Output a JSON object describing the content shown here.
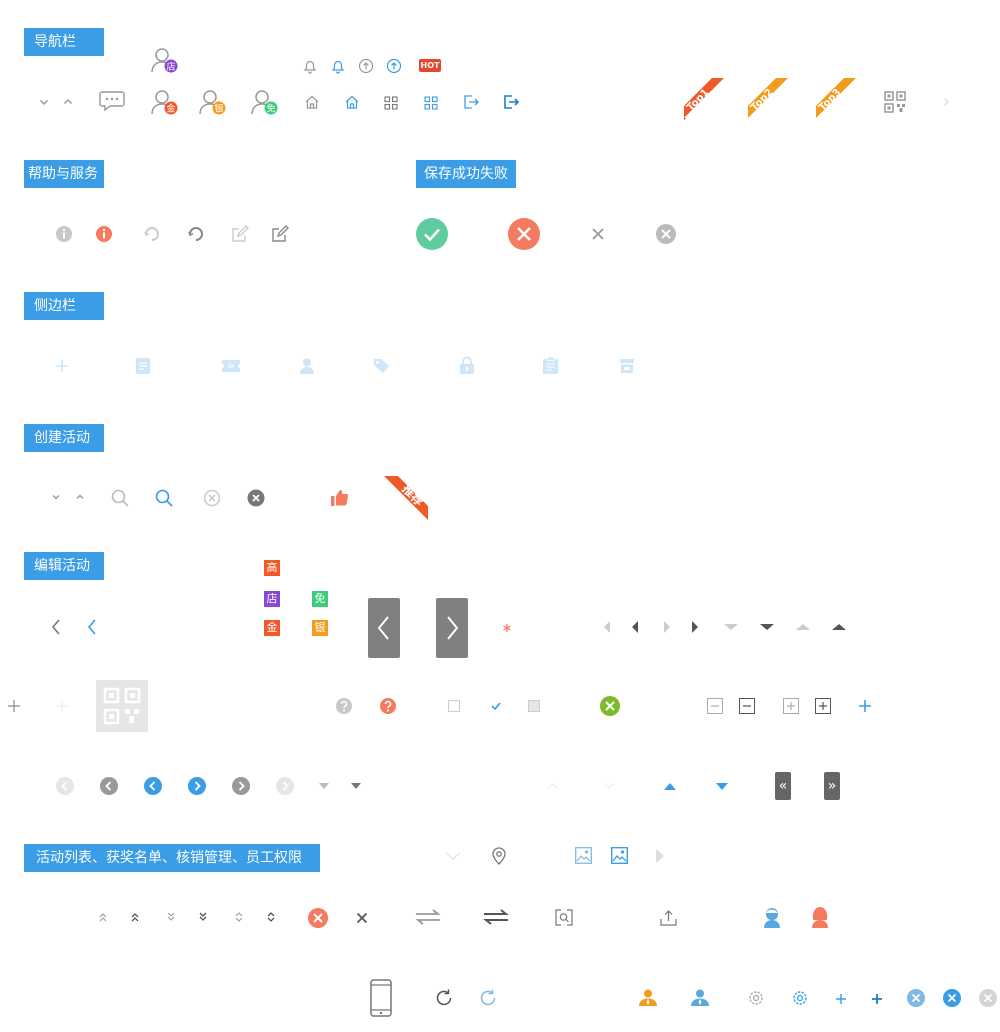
{
  "sections": {
    "nav": "导航栏",
    "help": "帮助与服务",
    "save": "保存成功失败",
    "sidebar": "侧边栏",
    "create": "创建活动",
    "edit": "编辑活动",
    "list": "活动列表、获奖名单、核销管理、员工权限"
  },
  "badges": {
    "shop": "店",
    "gold": "金",
    "silver": "银",
    "free": "免",
    "high": "高",
    "hot": "HOT",
    "top1": "Top1",
    "top2": "Top2",
    "top3": "Top3",
    "recommend": "推荐"
  },
  "colors": {
    "primary": "#3a9de5",
    "success": "#5ecc9e",
    "error": "#f47a60",
    "orange": "#f39b1e",
    "red": "#f05a28",
    "purple": "#8b47d6",
    "green": "#3dcc7a",
    "gray": "#999999",
    "light": "#cfe6f8"
  },
  "icons": [
    "chevron-down-icon",
    "chevron-up-icon",
    "message-icon",
    "user-shop-icon",
    "user-gold-icon",
    "user-silver-icon",
    "user-free-icon",
    "bell-icon",
    "arrow-up-circle-icon",
    "home-icon",
    "grid-icon",
    "logout-icon",
    "qr-code-icon",
    "info-icon",
    "refresh-icon",
    "edit-icon",
    "check-circle-icon",
    "close-circle-icon",
    "close-icon",
    "plus-icon",
    "document-icon",
    "ticket-icon",
    "user-icon",
    "tag-icon",
    "lock-icon",
    "clipboard-icon",
    "store-icon",
    "search-icon",
    "thumbs-up-icon",
    "chevron-left-icon",
    "chevron-right-icon",
    "asterisk-icon",
    "triangle-left-icon",
    "triangle-right-icon",
    "triangle-down-icon",
    "triangle-up-icon",
    "help-icon",
    "checkbox-icon",
    "minus-square-icon",
    "plus-square-icon",
    "double-left-icon",
    "double-right-icon",
    "location-icon",
    "image-icon",
    "double-up-icon",
    "double-down-icon",
    "sort-icon",
    "swap-icon",
    "scan-icon",
    "upload-icon",
    "avatar-male-icon",
    "avatar-female-icon",
    "phone-icon",
    "settings-icon",
    "staff-icon"
  ]
}
